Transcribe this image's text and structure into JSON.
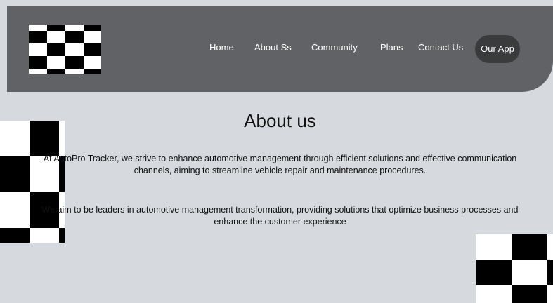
{
  "header": {
    "logo_name": "checkered-flag-logo",
    "nav": [
      {
        "label": "Home"
      },
      {
        "label": "About Ss"
      },
      {
        "label": "Community"
      },
      {
        "label": "Plans"
      },
      {
        "label": "Contact Us"
      }
    ],
    "app_button_label": "Our App"
  },
  "main": {
    "title": "About us",
    "paragraphs": [
      "At AutoPro Tracker, we strive to enhance automotive management through efficient solutions and effective communication channels, aiming to streamline vehicle repair and maintenance procedures.",
      "We aim to be leaders in automotive management transformation, providing solutions that optimize business processes and enhance the customer experience"
    ]
  },
  "colors": {
    "page_background": "#d6dade",
    "header_background": "#606265",
    "button_background": "#3a3b3d",
    "text": "#111111"
  }
}
